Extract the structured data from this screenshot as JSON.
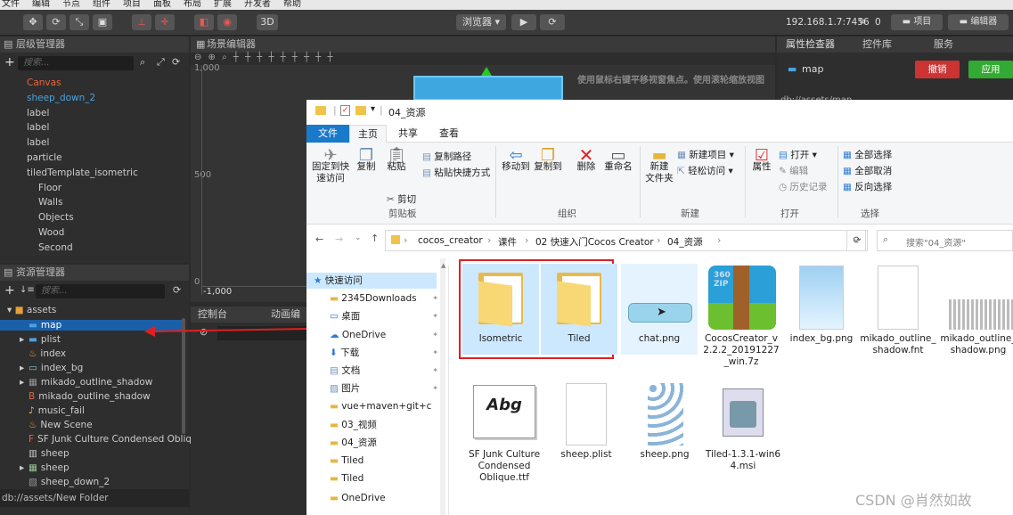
{
  "menubar": [
    "文件",
    "编辑",
    "节点",
    "组件",
    "项目",
    "面板",
    "布局",
    "扩展",
    "开发者",
    "帮助"
  ],
  "toolbar": {
    "mode_3d": "3D",
    "preview_dropdown": "浏览器 ▾",
    "ip": "192.168.1.7:7456",
    "wifi_count": "0",
    "project_btn": "项目",
    "editor_btn": "编辑器"
  },
  "hierarchy": {
    "title": "层级管理器",
    "search_placeholder": "搜索...",
    "items": [
      {
        "label": "Canvas",
        "color": "#e8643c",
        "indent": 30
      },
      {
        "label": "sheep_down_2",
        "color": "#4aa3df",
        "indent": 30
      },
      {
        "label": "label",
        "color": "#ccc",
        "indent": 30
      },
      {
        "label": "label",
        "color": "#ccc",
        "indent": 30
      },
      {
        "label": "label",
        "color": "#ccc",
        "indent": 30
      },
      {
        "label": "particle",
        "color": "#ccc",
        "indent": 30
      },
      {
        "label": "tiledTemplate_isometric",
        "color": "#ccc",
        "indent": 30
      },
      {
        "label": "Floor",
        "color": "#ccc",
        "indent": 43
      },
      {
        "label": "Walls",
        "color": "#ccc",
        "indent": 43
      },
      {
        "label": "Objects",
        "color": "#ccc",
        "indent": 43
      },
      {
        "label": "Wood",
        "color": "#ccc",
        "indent": 43
      },
      {
        "label": "Second",
        "color": "#ccc",
        "indent": 43
      }
    ]
  },
  "assets": {
    "title": "资源管理器",
    "search_placeholder": "搜索...",
    "root": "assets",
    "items": [
      {
        "label": "map",
        "selected": true
      },
      {
        "label": "plist"
      },
      {
        "label": "index"
      },
      {
        "label": "index_bg"
      },
      {
        "label": "mikado_outline_shadow"
      },
      {
        "label": "mikado_outline_shadow"
      },
      {
        "label": "music_fail"
      },
      {
        "label": "New Scene"
      },
      {
        "label": "SF Junk Culture Condensed Obliq"
      },
      {
        "label": "sheep"
      },
      {
        "label": "sheep"
      },
      {
        "label": "sheep_down_2"
      }
    ],
    "footer_path": "db://assets/New Folder"
  },
  "scene": {
    "title": "场景编辑器",
    "hint": "使用鼠标右键平移视窗焦点。使用滚轮缩放视图",
    "axis_labels": [
      "1,000",
      "500",
      "0",
      "-1,000"
    ]
  },
  "console": {
    "tab1": "控制台",
    "tab2": "动画编"
  },
  "inspector": {
    "tabs": [
      "属性检查器",
      "控件库",
      "服务"
    ],
    "node_name": "map",
    "revert_btn": "撤销",
    "apply_btn": "应用",
    "path": "db://assets/map"
  },
  "explorer": {
    "window_title": "04_资源",
    "tabs": [
      "文件",
      "主页",
      "共享",
      "查看"
    ],
    "groups": {
      "clipboard": {
        "label": "剪贴板",
        "pin": "固定到快速访问",
        "copy": "复制",
        "paste": "粘贴",
        "copy_path": "复制路径",
        "paste_shortcut": "粘贴快捷方式",
        "cut": "剪切"
      },
      "organize": {
        "label": "组织",
        "move_to": "移动到",
        "copy_to": "复制到",
        "delete": "删除",
        "rename": "重命名"
      },
      "new": {
        "label": "新建",
        "new_folder": "新建\n文件夹",
        "new_item": "新建项目 ▾",
        "easy_access": "轻松访问 ▾"
      },
      "open": {
        "label": "打开",
        "properties": "属性",
        "open": "打开 ▾",
        "edit": "编辑",
        "history": "历史记录"
      },
      "select": {
        "label": "选择",
        "select_all": "全部选择",
        "select_none": "全部取消",
        "invert": "反向选择"
      }
    },
    "breadcrumb": [
      "cocos_creator",
      "课件",
      "02 快速入门Cocos Creator",
      "04_资源"
    ],
    "search_placeholder": "搜索\"04_资源\"",
    "nav": [
      {
        "label": "快速访问",
        "icon": "star",
        "pinned": false,
        "selected": true
      },
      {
        "label": "2345Downloads",
        "icon": "folder",
        "pinned": true
      },
      {
        "label": "桌面",
        "icon": "desktop",
        "pinned": true
      },
      {
        "label": "OneDrive",
        "icon": "cloud",
        "pinned": true
      },
      {
        "label": "下载",
        "icon": "download",
        "pinned": true
      },
      {
        "label": "文档",
        "icon": "doc",
        "pinned": true
      },
      {
        "label": "图片",
        "icon": "pic",
        "pinned": true
      },
      {
        "label": "vue+maven+git+c",
        "icon": "folder",
        "pinned": false
      },
      {
        "label": "03_视频",
        "icon": "folder",
        "pinned": false
      },
      {
        "label": "04_资源",
        "icon": "folder",
        "pinned": false
      },
      {
        "label": "Tiled",
        "icon": "folder",
        "pinned": false
      },
      {
        "label": "Tiled",
        "icon": "folder",
        "pinned": false
      },
      {
        "label": "OneDrive",
        "icon": "folder",
        "pinned": false
      }
    ],
    "files_row1": [
      "Isometric",
      "Tiled",
      "chat.png",
      "CocosCreator_v2.2.2_20191227_win.7z",
      "index_bg.png",
      "mikado_outline_shadow.fnt",
      "mikado_outline_shadow.png"
    ],
    "files_row2": [
      "SF Junk Culture Condensed Oblique.ttf",
      "sheep.plist",
      "sheep.png",
      "Tiled-1.3.1-win64.msi"
    ],
    "font_preview": "Abg",
    "zip_label": "360\nZIP"
  },
  "watermark": "CSDN @肖然如故",
  "colors": {
    "accent": "#0078d7",
    "highlight_red": "#e02020",
    "selected_bg": "#cce8ff",
    "cocos_selected": "#1a5fa8"
  }
}
